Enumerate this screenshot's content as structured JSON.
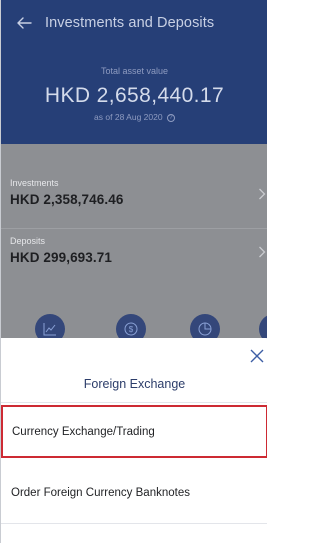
{
  "header": {
    "back_icon": "arrow-left-icon",
    "title": "Investments and Deposits"
  },
  "summary": {
    "total_label": "Total asset value",
    "total_value": "HKD 2,658,440.17",
    "as_of": "as of 28 Aug 2020",
    "info_icon_glyph": "?"
  },
  "accounts": [
    {
      "label": "Investments",
      "value": "HKD 2,358,746.46"
    },
    {
      "label": "Deposits",
      "value": "HKD 299,693.71"
    }
  ],
  "quick_icons": [
    "chart-line-icon",
    "dollar-circle-icon",
    "pie-chart-icon"
  ],
  "sheet": {
    "title": "Foreign Exchange",
    "close_icon": "close-icon",
    "options": [
      {
        "label": "Currency Exchange/Trading",
        "selected": true
      },
      {
        "label": "Order Foreign Currency Banknotes",
        "selected": false
      }
    ]
  },
  "colors": {
    "header_bg": "#263f77",
    "overlay_bg": "#8d8f93",
    "selection_border": "#cd2a33",
    "accent": "#3d5ea5"
  }
}
